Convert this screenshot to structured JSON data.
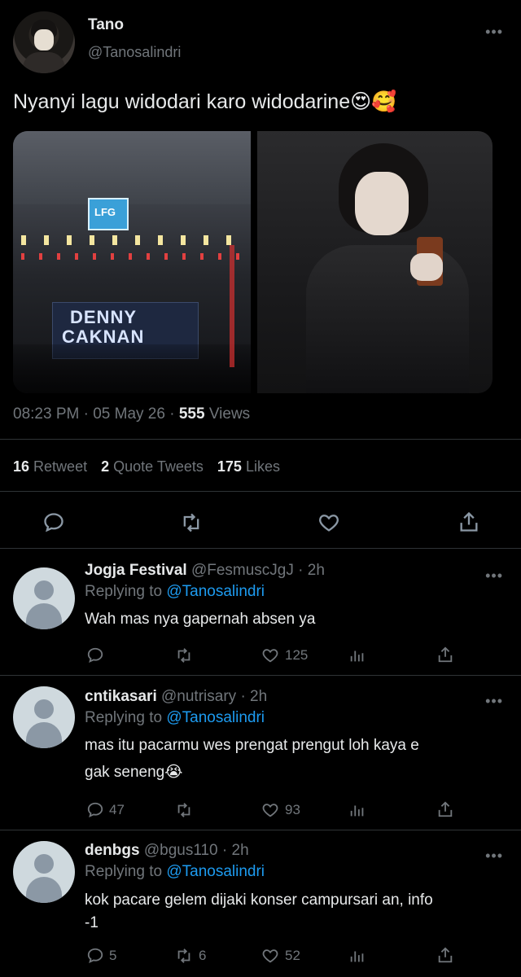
{
  "tweet": {
    "display_name": "Tano",
    "handle": "@Tanosalindri",
    "text": "Nyanyi lagu widodari karo widodarine😍🥰",
    "banner_top": "LFG",
    "banner_line1": "DENNY",
    "banner_line2": "CAKNAN",
    "time": "08:23 PM",
    "date": "05 May 26",
    "sep": "·",
    "views_count": "555",
    "views_label": "Views",
    "retweet_count": "16",
    "retweet_label": "Retweet",
    "quote_count": "2",
    "quote_label": "Quote Tweets",
    "likes_count": "175",
    "likes_label": "Likes"
  },
  "replies": [
    {
      "name": "Jogja Festival",
      "handle": "@FesmuscJgJ",
      "age": "· 2h",
      "replying_prefix": "Replying to",
      "replying_to": "@Tanosalindri",
      "text": "Wah mas nya gapernah absen ya",
      "comments": "",
      "retweets": "",
      "likes": "125"
    },
    {
      "name": "cntikasari",
      "handle": "@nutrisary",
      "age": "· 2h",
      "replying_prefix": "Replying to",
      "replying_to": "@Tanosalindri",
      "text_line1": "mas itu pacarmu wes prengat prengut loh kaya e",
      "text_line2": "gak seneng😭",
      "comments": "47",
      "retweets": "",
      "likes": "93"
    },
    {
      "name": "denbgs",
      "handle": "@bgus110",
      "age": "· 2h",
      "replying_prefix": "Replying to",
      "replying_to": "@Tanosalindri",
      "text_line1": "kok pacare gelem dijaki konser campursari an, info",
      "text_line2": "-1",
      "comments": "5",
      "retweets": "6",
      "likes": "52"
    }
  ],
  "more_glyph": "•••"
}
